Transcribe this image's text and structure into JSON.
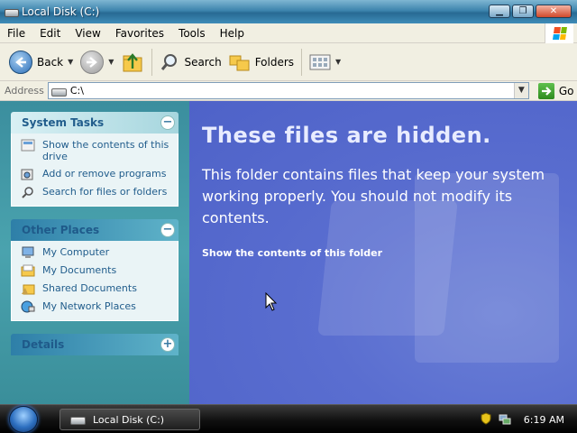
{
  "window": {
    "title": "Local Disk (C:)",
    "min_label": "▁",
    "max_label": "❐",
    "close_label": "✕"
  },
  "menu": {
    "items": [
      "File",
      "Edit",
      "View",
      "Favorites",
      "Tools",
      "Help"
    ]
  },
  "toolbar": {
    "back_label": "Back",
    "search_label": "Search",
    "folders_label": "Folders"
  },
  "address": {
    "label": "Address",
    "value": "C:\\",
    "go_label": "Go"
  },
  "system_tasks": {
    "title": "System Tasks",
    "items": [
      {
        "label": "Show the contents of this drive",
        "icon": "show-contents-icon"
      },
      {
        "label": "Add or remove programs",
        "icon": "add-remove-programs-icon"
      },
      {
        "label": "Search for files or folders",
        "icon": "search-icon"
      }
    ]
  },
  "other_places": {
    "title": "Other Places",
    "items": [
      {
        "label": "My Computer",
        "icon": "my-computer-icon"
      },
      {
        "label": "My Documents",
        "icon": "my-documents-icon"
      },
      {
        "label": "Shared Documents",
        "icon": "shared-documents-icon"
      },
      {
        "label": "My Network Places",
        "icon": "network-places-icon"
      }
    ]
  },
  "details": {
    "title": "Details"
  },
  "hidden_notice": {
    "title": "These files are hidden.",
    "message": "This folder contains files that keep your system working properly. You should not modify its contents.",
    "link": "Show the contents of this folder"
  },
  "taskbar": {
    "task_label": "Local Disk (C:)",
    "clock": "6:19 AM"
  },
  "colors": {
    "accent": "#215d8c",
    "taskpane": "#4aa3ae",
    "mainpane": "#5a6ed0"
  }
}
